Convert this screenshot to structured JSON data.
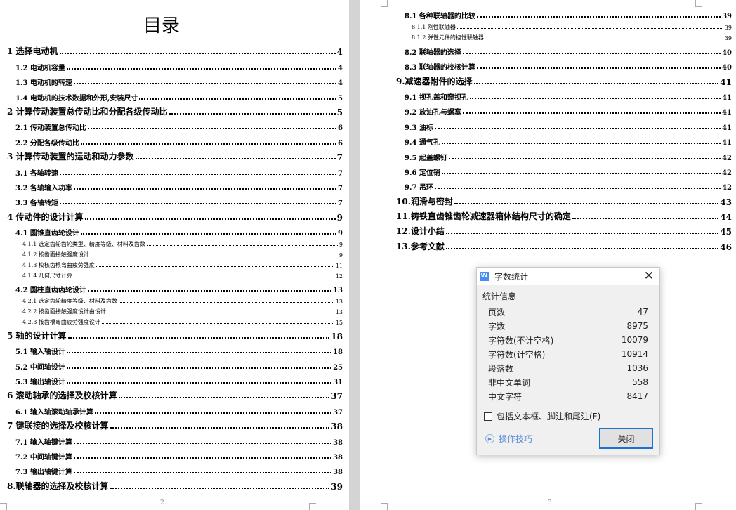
{
  "page1": {
    "title": "目录",
    "page_number": "2",
    "entries": [
      {
        "level": 1,
        "text": "1 选择电动机",
        "page": "4"
      },
      {
        "level": 2,
        "text": "1.2 电动机容量",
        "page": "4"
      },
      {
        "level": 2,
        "text": "1.3 电动机的转速",
        "page": "4"
      },
      {
        "level": 2,
        "text": "1.4 电动机的技术数据和外形,安装尺寸",
        "page": "5"
      },
      {
        "level": 1,
        "text": "2  计算传动装置总传动比和分配各级传动比",
        "page": "5"
      },
      {
        "level": 2,
        "text": "2.1 传动装置总传动比",
        "page": "6"
      },
      {
        "level": 2,
        "text": "2.2 分配各级传动比",
        "page": "6"
      },
      {
        "level": 1,
        "text": "3 计算传动装置的运动和动力参数",
        "page": "7"
      },
      {
        "level": 2,
        "text": "3.1 各轴转速",
        "page": "7"
      },
      {
        "level": 2,
        "text": "3.2 各轴输入功率",
        "page": "7"
      },
      {
        "level": 2,
        "text": "3.3 各轴转矩",
        "page": "7"
      },
      {
        "level": 1,
        "text": "4 传动件的设计计算",
        "page": "9"
      },
      {
        "level": 2,
        "text": "4.1 圆锥直齿轮设计",
        "page": "9"
      },
      {
        "level": 3,
        "text": "4.1.1 选定齿轮齿轮类型、精度等级、材料及齿数",
        "page": "9"
      },
      {
        "level": 3,
        "text": "4.1.2 按齿面接触强度设计",
        "page": "9"
      },
      {
        "level": 3,
        "text": "4.1.3 校核齿根弯曲疲劳强度",
        "page": "11"
      },
      {
        "level": 3,
        "text": "4.1.4 几何尺寸计算",
        "page": "12"
      },
      {
        "level": 2,
        "text": "4.2 圆柱直齿齿轮设计",
        "page": "13"
      },
      {
        "level": 3,
        "text": "4.2.1 选定齿轮精度等级、材料及齿数",
        "page": "13"
      },
      {
        "level": 3,
        "text": "4.2.2 按齿面接触强度设计由设计",
        "page": "13"
      },
      {
        "level": 3,
        "text": "4.2.3 按齿根弯曲疲劳强度设计",
        "page": "15"
      },
      {
        "level": 1,
        "text": "5 轴的设计计算",
        "page": "18"
      },
      {
        "level": 2,
        "text": "5.1 输入轴设计",
        "page": "18"
      },
      {
        "level": 2,
        "text": "5.2 中间轴设计",
        "page": "25"
      },
      {
        "level": 2,
        "text": "5.3 输出轴设计",
        "page": "31"
      },
      {
        "level": 1,
        "text": "6 滚动轴承的选择及校核计算",
        "page": "37"
      },
      {
        "level": 2,
        "text": "6.1 输入轴滚动轴承计算",
        "page": "37"
      },
      {
        "level": 1,
        "text": "7 键联接的选择及校核计算",
        "page": "38"
      },
      {
        "level": 2,
        "text": "7.1 输入轴键计算",
        "page": "38"
      },
      {
        "level": 2,
        "text": "7.2 中间轴键计算",
        "page": "38"
      },
      {
        "level": 2,
        "text": "7.3 输出轴键计算",
        "page": "38"
      },
      {
        "level": 1,
        "text": "8.联轴器的选择及校核计算",
        "page": "39"
      }
    ]
  },
  "page2": {
    "page_number": "3",
    "entries": [
      {
        "level": 2,
        "text": "8.1 各种联轴器的比较",
        "page": "39"
      },
      {
        "level": 3,
        "text": "8.1.1  刚性联轴器",
        "page": "39"
      },
      {
        "level": 3,
        "text": "8.1.2 弹性元件的挠性联轴器",
        "page": "39"
      },
      {
        "level": 2,
        "text": "8.2 联轴器的选择",
        "page": "40"
      },
      {
        "level": 2,
        "text": "8.3 联轴器的校核计算",
        "page": "40"
      },
      {
        "level": 1,
        "text": "9.减速器附件的选择",
        "page": "41"
      },
      {
        "level": 2,
        "text": "9.1 视孔盖和窥视孔",
        "page": "41"
      },
      {
        "level": 2,
        "text": "9.2 放油孔与螺塞",
        "page": "41"
      },
      {
        "level": 2,
        "text": "9.3 油标",
        "page": "41"
      },
      {
        "level": 2,
        "text": "9.4 通气孔",
        "page": "41"
      },
      {
        "level": 2,
        "text": "9.5 起盖螺钉",
        "page": "42"
      },
      {
        "level": 2,
        "text": "9.6 定位销",
        "page": "42"
      },
      {
        "level": 2,
        "text": "9.7 吊环",
        "page": "42"
      },
      {
        "level": 1,
        "text": "10.润滑与密封",
        "page": "43"
      },
      {
        "level": 1,
        "text": "11.铸铁直齿锥齿轮减速器箱体结构尺寸的确定",
        "page": "44"
      },
      {
        "level": 1,
        "text": "12.设计小结",
        "page": "45"
      },
      {
        "level": 1,
        "text": "13.参考文献",
        "page": "46"
      }
    ]
  },
  "dialog": {
    "app_icon": "W",
    "title": "字数统计",
    "section": "统计信息",
    "stats": [
      {
        "label": "页数",
        "value": "47"
      },
      {
        "label": "字数",
        "value": "8975"
      },
      {
        "label": "字符数(不计空格)",
        "value": "10079"
      },
      {
        "label": "字符数(计空格)",
        "value": "10914"
      },
      {
        "label": "段落数",
        "value": "1036"
      },
      {
        "label": "非中文单词",
        "value": "558"
      },
      {
        "label": "中文字符",
        "value": "8417"
      }
    ],
    "checkbox_label": "包括文本框、脚注和尾注(F)",
    "checkbox_checked": false,
    "tips_label": "操作技巧",
    "close_button": "关闭"
  }
}
